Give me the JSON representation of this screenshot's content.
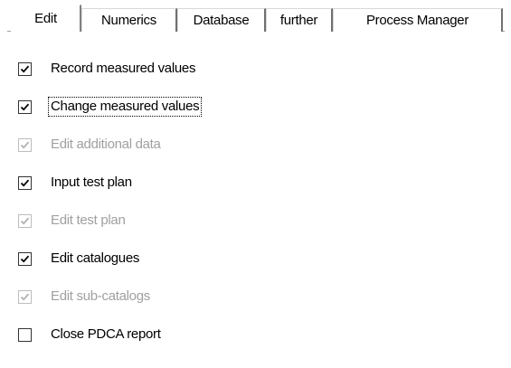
{
  "tabs": [
    {
      "label": "Edit",
      "active": true
    },
    {
      "label": "Numerics",
      "active": false
    },
    {
      "label": "Database",
      "active": false
    },
    {
      "label": "further",
      "active": false
    },
    {
      "label": "Process Manager",
      "active": false
    }
  ],
  "options": [
    {
      "label": "Record measured values",
      "checked": true,
      "enabled": true,
      "focused": false
    },
    {
      "label": "Change measured values",
      "checked": true,
      "enabled": true,
      "focused": true
    },
    {
      "label": "Edit additional data",
      "checked": true,
      "enabled": false,
      "focused": false
    },
    {
      "label": "Input test plan",
      "checked": true,
      "enabled": true,
      "focused": false
    },
    {
      "label": "Edit test plan",
      "checked": true,
      "enabled": false,
      "focused": false
    },
    {
      "label": "Edit catalogues",
      "checked": true,
      "enabled": true,
      "focused": false
    },
    {
      "label": "Edit sub-catalogs",
      "checked": true,
      "enabled": false,
      "focused": false
    },
    {
      "label": "Close PDCA report",
      "checked": false,
      "enabled": true,
      "focused": false
    }
  ],
  "colors": {
    "check_enabled": "#000000",
    "check_disabled": "#b0b0b0",
    "text_disabled": "#a0a0a0"
  }
}
